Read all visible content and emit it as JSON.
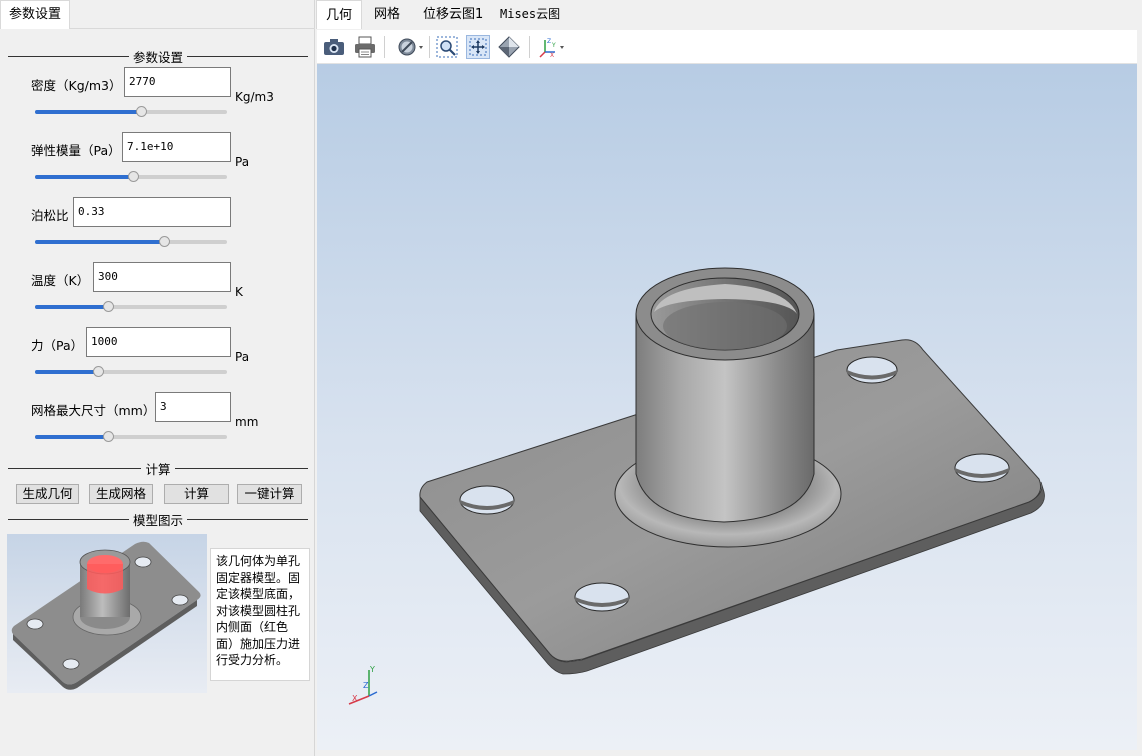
{
  "left_tab": {
    "label": "参数设置"
  },
  "params_group": {
    "title": "参数设置",
    "fields": [
      {
        "label": "密度（Kg/m3）",
        "value": "2770",
        "unit": "Kg/m3",
        "slider_fraction": 0.55
      },
      {
        "label": "弹性模量（Pa）",
        "value": "7.1e+10",
        "unit": "Pa",
        "slider_fraction": 0.51
      },
      {
        "label": "泊松比",
        "value": "0.33",
        "unit": "",
        "slider_fraction": 0.67
      },
      {
        "label": "温度（K）",
        "value": "300",
        "unit": "K",
        "slider_fraction": 0.38
      },
      {
        "label": "力（Pa）",
        "value": "1000",
        "unit": "Pa",
        "slider_fraction": 0.33
      },
      {
        "label": "网格最大尺寸（mm）",
        "value": "3",
        "unit": "mm",
        "slider_fraction": 0.38
      }
    ]
  },
  "calc_group": {
    "title": "计算",
    "buttons": [
      "生成几何",
      "生成网格",
      "计算",
      "一键计算"
    ]
  },
  "model_group": {
    "title": "模型图示",
    "description": "该几何体为单孔固定器模型。固定该模型底面，对该模型圆柱孔内侧面（红色面）施加压力进行受力分析。"
  },
  "view_tabs": [
    "几何",
    "网格",
    "位移云图1",
    "Mises云图"
  ],
  "active_view_tab": "几何",
  "toolbar": [
    "camera-icon",
    "print-icon",
    "display-mode-icon",
    "zoom-window-icon",
    "fit-all-icon",
    "view-projection-icon",
    "axis-view-icon"
  ],
  "axes": {
    "x": "X",
    "y": "Y",
    "z": "Z"
  },
  "colors": {
    "accent": "#2f6fd0",
    "highlight_face": "#ff6b6b",
    "model_gray": "#9a9a9a"
  }
}
